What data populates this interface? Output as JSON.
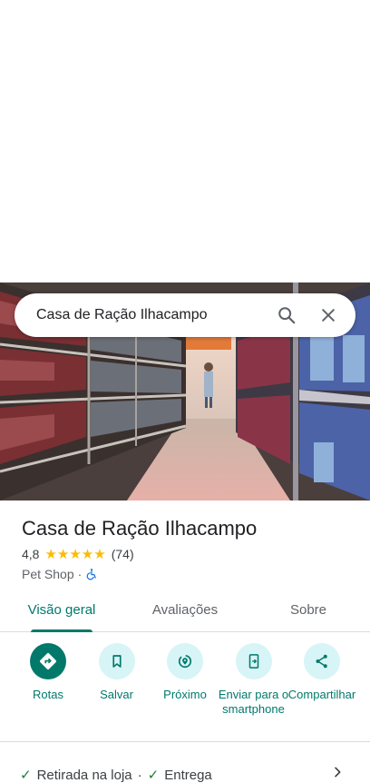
{
  "search": {
    "query": "Casa de Ração Ilhacampo"
  },
  "place": {
    "name": "Casa de Ração Ilhacampo",
    "rating": "4,8",
    "stars": "★★★★★",
    "review_count": "(74)",
    "category": "Pet Shop",
    "separator": "·"
  },
  "tabs": [
    {
      "label": "Visão geral",
      "active": true
    },
    {
      "label": "Avaliações",
      "active": false
    },
    {
      "label": "Sobre",
      "active": false
    }
  ],
  "actions": [
    {
      "label": "Rotas",
      "icon": "directions-icon"
    },
    {
      "label": "Salvar",
      "icon": "bookmark-icon"
    },
    {
      "label": "Próximo",
      "icon": "nearby-icon"
    },
    {
      "label": "Enviar para o smartphone",
      "icon": "send-to-phone-icon"
    },
    {
      "label": "Compartilhar",
      "icon": "share-icon"
    }
  ],
  "services": {
    "item1": "Retirada na loja",
    "separator": "·",
    "item2": "Entrega"
  },
  "colors": {
    "accent": "#00796b",
    "chip": "#d7f4f7",
    "star": "#fbbc04",
    "check": "#188038"
  }
}
